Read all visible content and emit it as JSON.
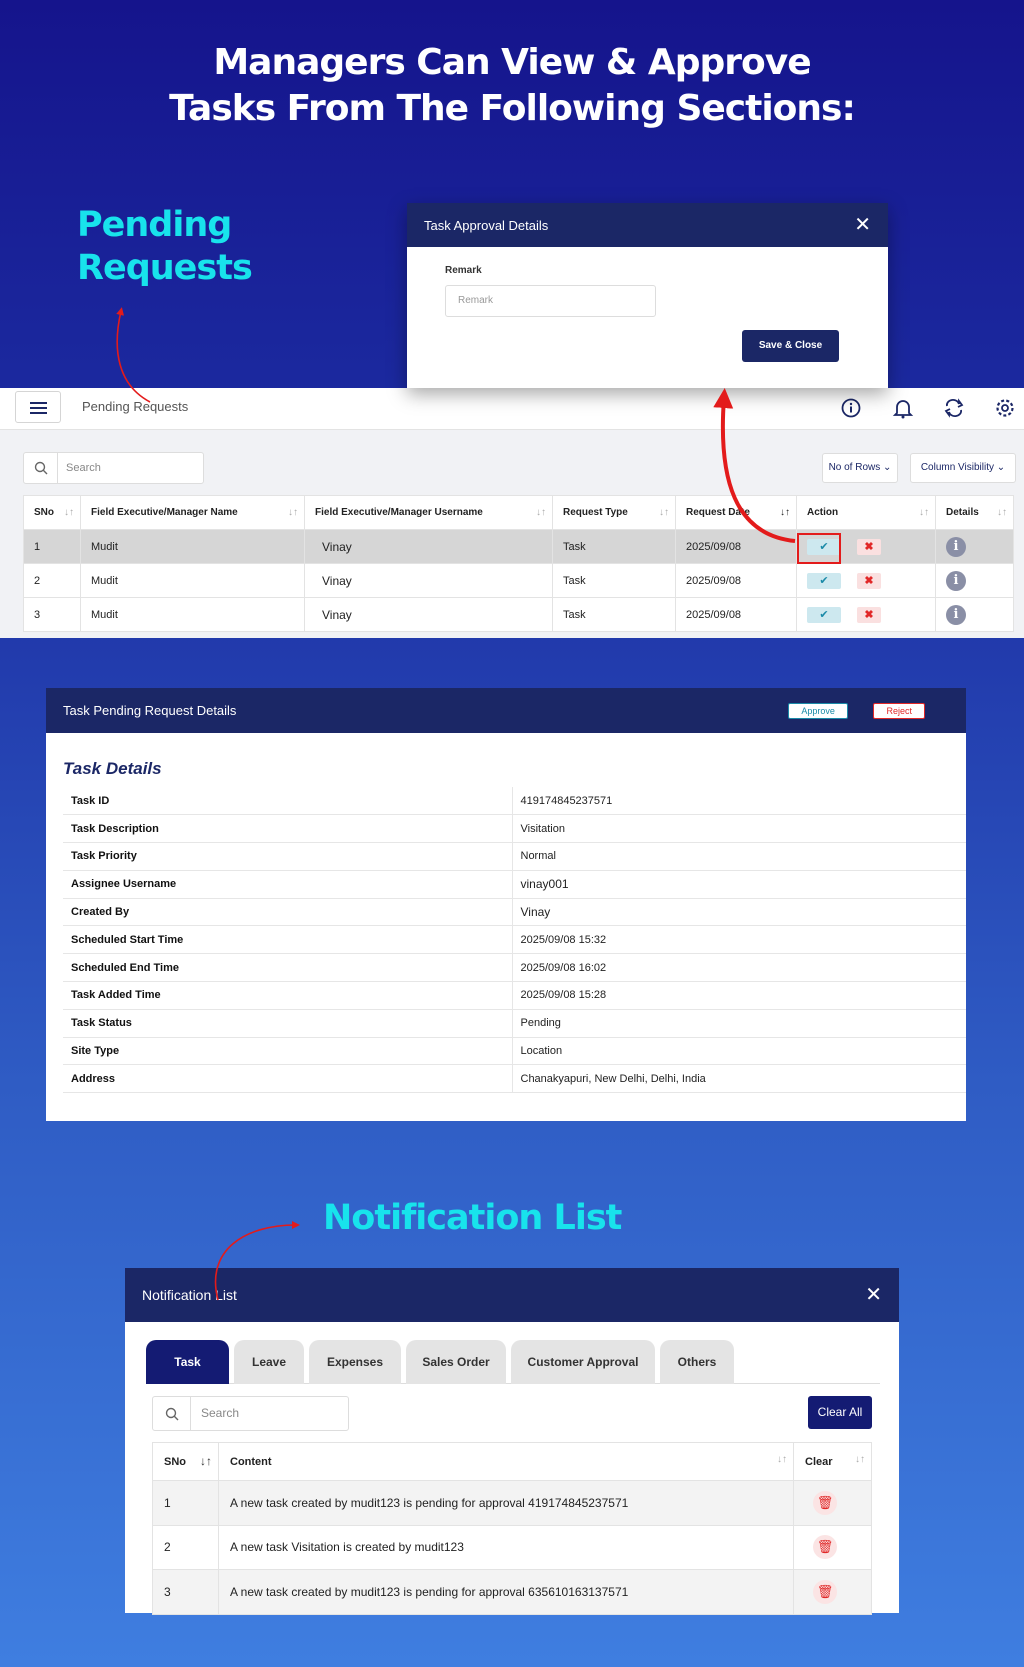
{
  "headline": {
    "line1": "Managers Can View & Approve",
    "line2": "Tasks From The Following Sections:"
  },
  "section_titles": {
    "pending": [
      "Pending",
      "Requests"
    ],
    "notification": "Notification List"
  },
  "approval_modal": {
    "title": "Task Approval Details",
    "remark_label": "Remark",
    "remark_placeholder": "Remark",
    "save_label": "Save & Close"
  },
  "pending_app": {
    "page_title": "Pending Requests",
    "search_placeholder": "Search",
    "rows_button": "No of Rows",
    "visibility_button": "Column Visibility",
    "columns": [
      "SNo",
      "Field Executive/Manager Name",
      "Field Executive/Manager Username",
      "Request Type",
      "Request Date",
      "Action",
      "Details"
    ],
    "rows": [
      {
        "sno": "1",
        "name": "Mudit",
        "username": "Vinay",
        "type": "Task",
        "date": "2025/09/08"
      },
      {
        "sno": "2",
        "name": "Mudit",
        "username": "Vinay",
        "type": "Task",
        "date": "2025/09/08"
      },
      {
        "sno": "3",
        "name": "Mudit",
        "username": "Vinay",
        "type": "Task",
        "date": "2025/09/08"
      }
    ]
  },
  "task_details": {
    "modal_title": "Task Pending Request Details",
    "approve_label": "Approve",
    "reject_label": "Reject",
    "section_title": "Task Details",
    "fields": [
      {
        "key": "Task ID",
        "value": "419174845237571"
      },
      {
        "key": "Task Description",
        "value": "Visitation"
      },
      {
        "key": "Task Priority",
        "value": "Normal"
      },
      {
        "key": "Assignee Username",
        "value": "vinay001"
      },
      {
        "key": "Created By",
        "value": "Vinay"
      },
      {
        "key": "Scheduled Start Time",
        "value": "2025/09/08 15:32"
      },
      {
        "key": "Scheduled End Time",
        "value": "2025/09/08 16:02"
      },
      {
        "key": "Task Added Time",
        "value": "2025/09/08 15:28"
      },
      {
        "key": "Task Status",
        "value": "Pending"
      },
      {
        "key": "Site Type",
        "value": "Location"
      },
      {
        "key": "Address",
        "value": "Chanakyapuri, New Delhi, Delhi, India"
      }
    ]
  },
  "notification_list": {
    "title": "Notification List",
    "tabs": [
      "Task",
      "Leave",
      "Expenses",
      "Sales Order",
      "Customer Approval",
      "Others"
    ],
    "search_placeholder": "Search",
    "clear_all_label": "Clear All",
    "columns": [
      "SNo",
      "Content",
      "Clear"
    ],
    "rows": [
      {
        "sno": "1",
        "content": "A new task created by mudit123 is pending for approval 419174845237571"
      },
      {
        "sno": "2",
        "content": "A new task Visitation is created by mudit123"
      },
      {
        "sno": "3",
        "content": "A new task created by mudit123 is pending for approval 635610163137571"
      }
    ]
  },
  "colors": {
    "modal_header": "#1b2766",
    "accent_cyan": "#18e3ec",
    "arrow_red": "#e31b1b",
    "approve_teal": "#1a8aa8",
    "reject_red": "#e12828"
  }
}
